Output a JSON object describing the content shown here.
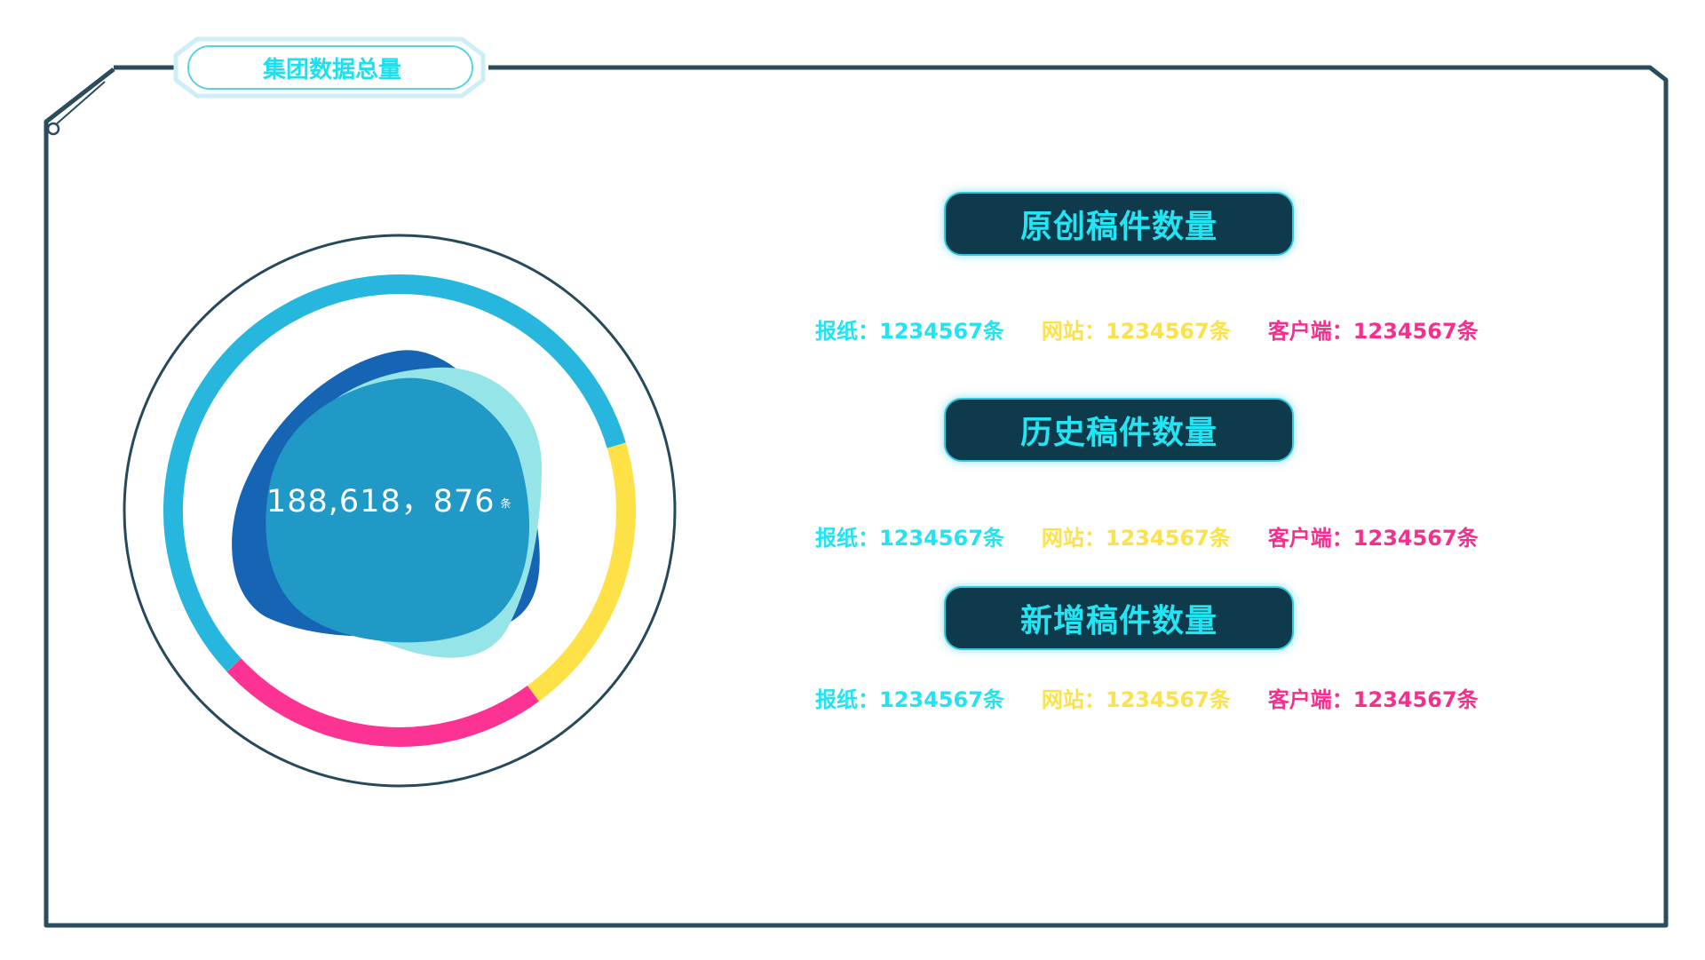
{
  "panel": {
    "title": "集团数据总量"
  },
  "total": {
    "value": "188,618，876",
    "unit": "条"
  },
  "ring": {
    "segments": [
      {
        "name": "newspaper",
        "color": "#27b7de",
        "fraction": 0.573
      },
      {
        "name": "website",
        "color": "#fde146",
        "fraction": 0.196
      },
      {
        "name": "client",
        "color": "#fc3392",
        "fraction": 0.231
      }
    ]
  },
  "colors": {
    "frame": "#2b4c5e",
    "pill_bg": "#0e3a4b",
    "cyan": "#20e4f2",
    "yellow": "#fbe24b",
    "pink": "#f72f8c"
  },
  "sections": [
    {
      "title": "原创稿件数量",
      "stats": [
        {
          "label": "报纸：1234567条"
        },
        {
          "label": "网站：1234567条"
        },
        {
          "label": "客户端：1234567条"
        }
      ]
    },
    {
      "title": "历史稿件数量",
      "stats": [
        {
          "label": "报纸：1234567条"
        },
        {
          "label": "网站：1234567条"
        },
        {
          "label": "客户端：1234567条"
        }
      ]
    },
    {
      "title": "新增稿件数量",
      "stats": [
        {
          "label": "报纸：1234567条"
        },
        {
          "label": "网站：1234567条"
        },
        {
          "label": "客户端：1234567条"
        }
      ]
    }
  ]
}
